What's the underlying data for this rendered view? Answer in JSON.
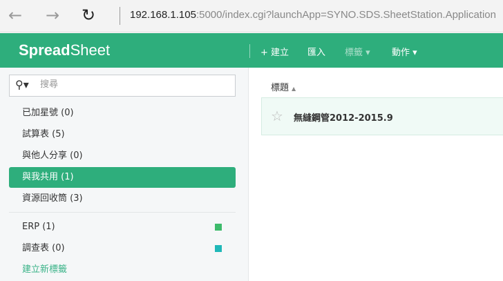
{
  "browser": {
    "back": "←",
    "forward": "→",
    "refresh": "↻",
    "url_host": "192.168.1.105",
    "url_rest": ":5000/index.cgi?launchApp=SYNO.SDS.SheetStation.Application"
  },
  "header": {
    "logo_bold": "Spread",
    "logo_light": "Sheet",
    "create": "+ 建立",
    "import": "匯入",
    "tags": "標籤 ▾",
    "actions": "動作 ▾"
  },
  "sidebar": {
    "search_placeholder": "搜尋",
    "items": [
      {
        "label": "已加星號 (0)"
      },
      {
        "label": "試算表 (5)"
      },
      {
        "label": "與他人分享 (0)"
      },
      {
        "label": "與我共用 (1)"
      },
      {
        "label": "資源回收筒 (3)"
      }
    ],
    "tags": [
      {
        "label": "ERP (1)",
        "color": "#3dbb6b"
      },
      {
        "label": "調查表 (0)",
        "color": "#1fb8b8"
      }
    ],
    "new_tag": "建立新標籤"
  },
  "main": {
    "column_title": "標題",
    "sort": "▲",
    "files": [
      {
        "name": "無縫鋼管2012-2015.9"
      }
    ]
  }
}
